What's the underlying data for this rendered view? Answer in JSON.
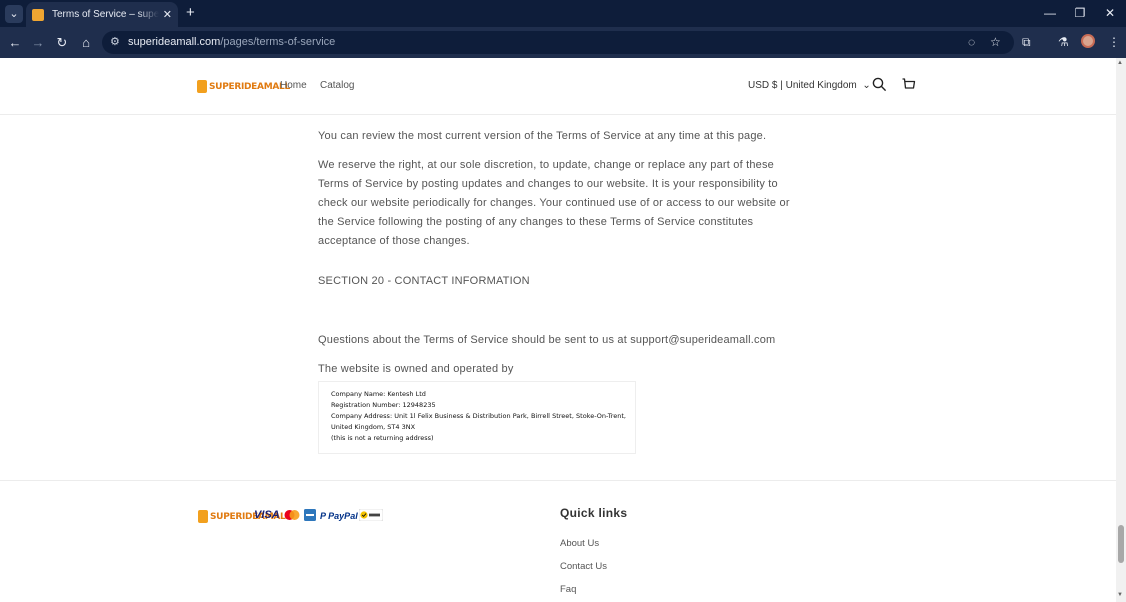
{
  "browser": {
    "tab_title": "Terms of Service – superideamall",
    "url_host": "superideamall.com",
    "url_path": "/pages/terms-of-service",
    "icons": {
      "tab_menu": "chevron-down-icon",
      "back": "arrow-left-icon",
      "forward": "arrow-right-icon",
      "reload": "reload-icon",
      "home": "home-icon"
    }
  },
  "header": {
    "logo_text": "SUPERIDEAMALL",
    "nav": {
      "home": "Home",
      "catalog": "Catalog"
    },
    "currency": "USD $ | United Kingdom"
  },
  "content": {
    "p1": "You can review the most current version of the Terms of Service at any time at this page.",
    "p2": "We reserve the right, at our sole discretion, to update, change or replace any part of these Terms of Service by posting updates and changes to our website. It is your responsibility to check our website periodically for changes. Your continued use of or access to our website or the Service following the posting of any changes to these Terms of Service constitutes acceptance of those changes.",
    "section_title": "SECTION 20 - CONTACT INFORMATION",
    "p3": "Questions about the Terms of Service should be sent to us at support@superideamall.com",
    "p4": "The website is owned and operated by",
    "company": {
      "name": "Company Name: Kentesh Ltd",
      "registration": "Registration Number: 12948235",
      "address_1": "Company Address: Unit 1l Felix Business & Distribution Park, Birrell Street, Stoke-On-Trent,",
      "address_2": "United Kingdom, ST4 3NX",
      "note": "(this is not a returning address)"
    }
  },
  "footer": {
    "logo_text": "SUPERIDEAMALL",
    "payments": {
      "visa": "VISA",
      "paypal": "PayPal"
    },
    "quick_links_title": "Quick links",
    "links": {
      "about": "About Us",
      "contact": "Contact Us",
      "faq": "Faq"
    }
  },
  "colors": {
    "chrome_dark": "#0e1d3a",
    "chrome_mid": "#1f2e4d",
    "logo_orange": "#f2a01e",
    "text": "#555555"
  }
}
